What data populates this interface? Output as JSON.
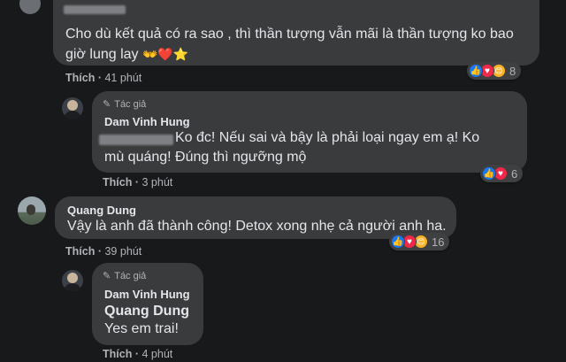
{
  "comments": [
    {
      "text": "Cho dù kết quả có ra sao , thì thần tượng vẫn mãi là thần tượng ko bao giờ lung lay",
      "emojis": "👐❤️⭐",
      "like_label": "Thích",
      "time": "41 phút",
      "reaction_count": "8",
      "reactions": [
        "like-icon",
        "love-icon",
        "care-icon"
      ]
    },
    {
      "badge": "Tác giả",
      "author": "Dam Vinh Hung",
      "text": "Ko đc! Nếu sai và bậy là phải loại ngay em ạ! Ko mù quáng! Đúng thì ngưỡng mộ",
      "like_label": "Thích",
      "time": "3 phút",
      "reaction_count": "6",
      "reactions": [
        "like-icon",
        "love-icon"
      ]
    },
    {
      "author": "Quang Dung",
      "text": "Vậy là anh đã thành công! Detox xong nhẹ cả người anh ha.",
      "like_label": "Thích",
      "time": "39 phút",
      "reaction_count": "16",
      "reactions": [
        "like-icon",
        "love-icon",
        "care-icon"
      ]
    },
    {
      "badge": "Tác giả",
      "author": "Dam Vinh Hung",
      "mention": "Quang Dung",
      "text": "Yes em trai!",
      "like_label": "Thích",
      "time": "4 phút"
    }
  ],
  "separator": "·",
  "colors": {
    "background": "#18191a",
    "bubble": "#3a3b3c",
    "text": "#e4e6eb",
    "secondary": "#b0b3b8",
    "like": "#1877f2",
    "love": "#f02849",
    "care": "#f7b125"
  }
}
